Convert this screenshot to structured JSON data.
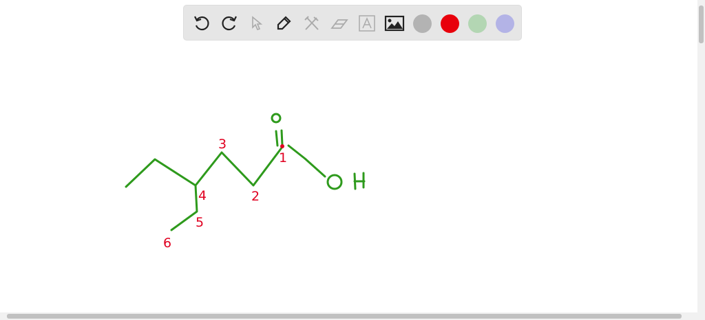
{
  "toolbar": {
    "tools": [
      "undo-icon",
      "redo-icon",
      "select-icon",
      "pen-icon",
      "tools-icon",
      "eraser-icon",
      "text-icon",
      "image-icon"
    ],
    "colors": [
      "#b3b3b3",
      "#e8000b",
      "#b3d6b3",
      "#b3b3e6"
    ]
  },
  "drawing": {
    "stroke_color": "#2e9a1c",
    "label_color": "#e00020",
    "atoms": {
      "oxygen_top": "O",
      "hydroxyl_o": "O",
      "hydroxyl_h": "H"
    },
    "carbon_numbers": [
      "1",
      "2",
      "3",
      "4",
      "5",
      "6"
    ]
  }
}
